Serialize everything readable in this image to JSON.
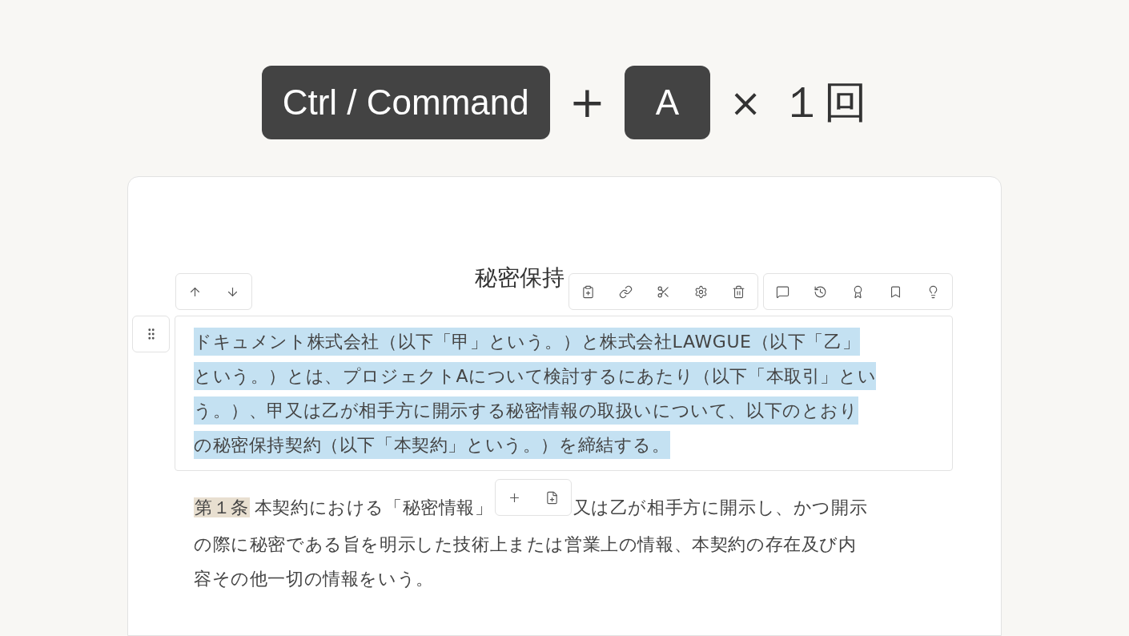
{
  "shortcut": {
    "keys": [
      "Ctrl / Command",
      "A"
    ],
    "joiner": "+",
    "multiplier": "×",
    "count": "１回"
  },
  "document": {
    "title": "秘密保持",
    "blocks": [
      {
        "lines": [
          [
            "ドキュメント株式会社（以下「甲」という。）と株式会社LAWGUE（以下「乙」"
          ],
          [
            "という。）とは、プロジェクトAについて検討するにあたり（以下「本取引」とい"
          ],
          [
            "う。）、甲又は乙が相手方に開示する秘密情報の取扱いについて、以下のとおり"
          ],
          [
            "の秘密保持契約（以下「本契約」という。）を締結する。"
          ]
        ],
        "selected": true
      },
      {
        "label": "第１条",
        "lines": [
          [
            "本契約における「秘密情報」",
            "又は乙が相手方に開示し、かつ開示"
          ],
          [
            "の際に秘密である旨を明示した技術上または営業上の情報、本契約の存在及び内"
          ],
          [
            "容その他一切の情報をいう。"
          ]
        ],
        "selected": false
      }
    ]
  }
}
